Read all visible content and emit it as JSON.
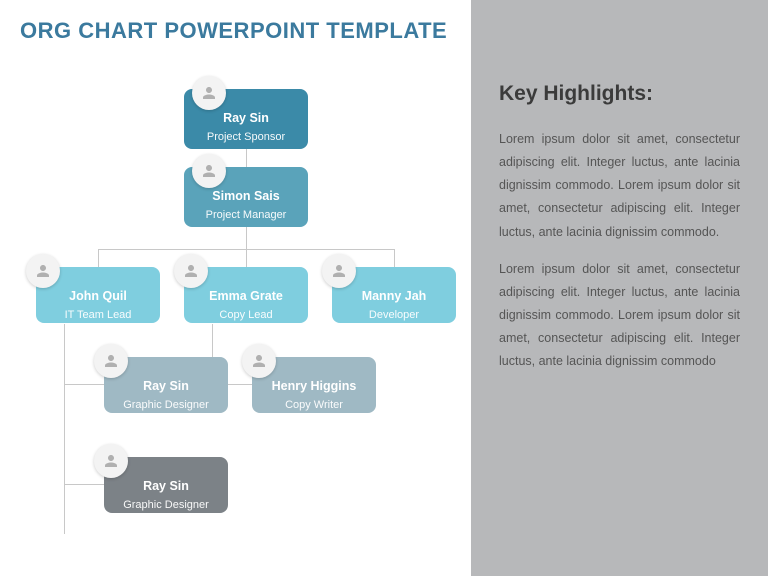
{
  "title": "ORG CHART POWERPOINT TEMPLATE",
  "nodes": {
    "n0": {
      "name": "Ray Sin",
      "role": "Project Sponsor"
    },
    "n1": {
      "name": "Simon Sais",
      "role": "Project Manager"
    },
    "n2": {
      "name": "John Quil",
      "role": "IT Team Lead"
    },
    "n3": {
      "name": "Emma Grate",
      "role": "Copy Lead"
    },
    "n4": {
      "name": "Manny Jah",
      "role": "Developer"
    },
    "n5": {
      "name": "Ray Sin",
      "role": "Graphic Designer"
    },
    "n6": {
      "name": "Henry Higgins",
      "role": "Copy Writer"
    },
    "n7": {
      "name": "Ray Sin",
      "role": "Graphic Designer"
    }
  },
  "highlights": {
    "heading": "Key Highlights:",
    "p1": "Lorem ipsum dolor sit amet, consectetur adipiscing elit. Integer luctus, ante lacinia dignissim commodo. Lorem ipsum dolor sit amet, consectetur adipiscing elit. Integer luctus, ante lacinia dignissim commodo.",
    "p2": "Lorem ipsum dolor sit amet, consectetur adipiscing elit. Integer luctus, ante lacinia dignissim commodo. Lorem ipsum dolor sit amet, consectetur adipiscing elit. Integer luctus, ante lacinia dignissim commodo"
  }
}
